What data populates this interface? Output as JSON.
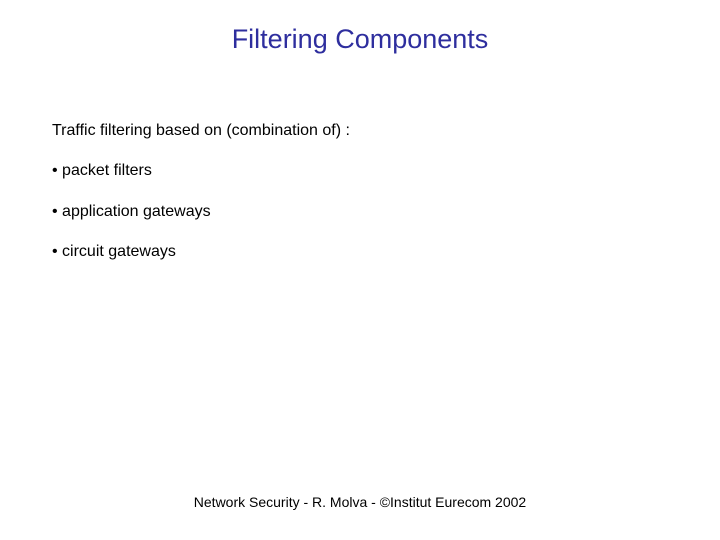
{
  "slide": {
    "title": "Filtering Components",
    "intro": "Traffic filtering based on (combination of) :",
    "bullets": [
      "• packet filters",
      "• application gateways",
      "• circuit gateways"
    ],
    "footer": "Network Security - R. Molva - ©Institut Eurecom 2002"
  }
}
